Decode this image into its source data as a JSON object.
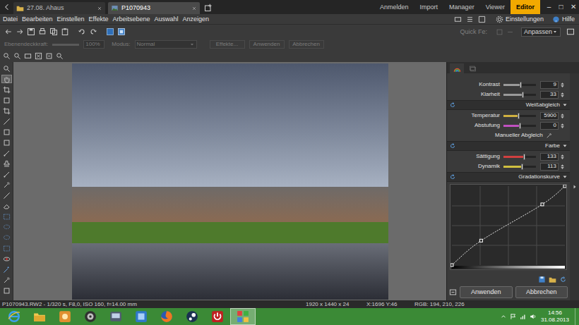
{
  "title_bar": {
    "tabs": [
      {
        "label": "27.08. Ahaus",
        "selected": false
      },
      {
        "label": "P1070943",
        "selected": true
      }
    ],
    "modes": [
      {
        "label": "Anmelden",
        "selected": false
      },
      {
        "label": "Import",
        "selected": false
      },
      {
        "label": "Manager",
        "selected": false
      },
      {
        "label": "Viewer",
        "selected": false
      },
      {
        "label": "Editor",
        "selected": true
      }
    ],
    "window_controls": [
      "–",
      "□",
      "✕"
    ]
  },
  "menu": {
    "items": [
      "Datei",
      "Bearbeiten",
      "Einstellen",
      "Effekte",
      "Arbeitsebene",
      "Auswahl",
      "Anzeigen"
    ],
    "settings": "Einstellungen",
    "help": "Hilfe"
  },
  "toolbar": {
    "quick_fix": "Quick Fe:",
    "fit": "Anpassen"
  },
  "options_bar": {
    "opacity": {
      "label": "Ebenendeckkraft:",
      "value": "100%",
      "level": 1,
      "disabled": true
    },
    "mode": {
      "label": "Modus:",
      "value": "Normal",
      "disabled": true
    },
    "buttons": [
      {
        "label": "Effekte...",
        "disabled": true
      },
      {
        "label": "Anwenden",
        "disabled": true
      },
      {
        "label": "Abbrechen",
        "disabled": true
      }
    ]
  },
  "tools": [
    {
      "kind": "zoom",
      "selected": false
    },
    {
      "kind": "hand",
      "selected": true
    },
    {
      "kind": "crop",
      "selected": false
    },
    {
      "kind": "square",
      "selected": false
    },
    {
      "kind": "crop",
      "selected": false
    },
    {
      "kind": "line",
      "selected": false
    },
    {
      "kind": "square",
      "selected": false
    },
    {
      "kind": "square",
      "selected": false
    },
    {
      "kind": "brush",
      "selected": false
    },
    {
      "kind": "stamp",
      "selected": false
    },
    {
      "kind": "brush",
      "selected": false
    },
    {
      "kind": "dropper",
      "selected": false
    },
    {
      "kind": "line",
      "selected": false
    },
    {
      "kind": "eraser",
      "selected": false
    },
    {
      "kind": "select",
      "selected": false
    },
    {
      "kind": "lasso",
      "selected": false
    },
    {
      "kind": "lasso",
      "selected": false
    },
    {
      "kind": "select",
      "selected": false
    },
    {
      "kind": "redeye",
      "selected": false
    },
    {
      "kind": "wand",
      "selected": false
    },
    {
      "kind": "dropper",
      "selected": false
    },
    {
      "kind": "square",
      "selected": false
    }
  ],
  "panel": {
    "tabs": [
      {
        "kind": "develop",
        "selected": true
      },
      {
        "kind": "layers",
        "selected": false
      }
    ],
    "rows": [
      {
        "kind": "slider",
        "label": "Kontrast",
        "value": "9",
        "level": 0.52,
        "color": "#9a9a9a"
      },
      {
        "kind": "slider",
        "label": "Klarheit",
        "value": "33",
        "level": 0.58,
        "color": "#9a9a9a"
      },
      {
        "kind": "header",
        "label": "Weißabgleich",
        "expanded": true
      },
      {
        "kind": "slider",
        "label": "Temperatur",
        "value": "5900",
        "level": 0.45,
        "color": "#d0b040"
      },
      {
        "kind": "slider",
        "label": "Abstufung",
        "value": "0",
        "level": 0.5,
        "color": "#c050c0"
      },
      {
        "kind": "button",
        "label": "Manueller Abgleich"
      },
      {
        "kind": "header",
        "label": "Farbe",
        "expanded": true
      },
      {
        "kind": "slider",
        "label": "Sättigung",
        "value": "133",
        "level": 0.62,
        "color": "#d04040"
      },
      {
        "kind": "slider",
        "label": "Dynamik",
        "value": "113",
        "level": 0.57,
        "color": "#d0c040"
      },
      {
        "kind": "header",
        "label": "Gradationskurve",
        "expanded": true
      }
    ],
    "curve": {
      "points": [
        [
          0,
          0
        ],
        [
          66,
          79
        ],
        [
          204,
          196
        ],
        [
          255,
          255
        ]
      ]
    },
    "buttons": [
      "Anwenden",
      "Abbrechen"
    ]
  },
  "status_bar": {
    "file_info": "P1070943.RW2 - 1/320 s, F8,0, ISO 160, f=14.00 mm",
    "dimensions": "1920 x 1440 x 24",
    "cursor": "X:1696 Y:46",
    "rgb": "RGB: 194, 210, 226"
  },
  "taskbar": {
    "apps": [
      {
        "kind": "ie",
        "selected": false
      },
      {
        "kind": "explorer",
        "selected": false
      },
      {
        "kind": "tool",
        "selected": false
      },
      {
        "kind": "disc",
        "selected": false
      },
      {
        "kind": "game",
        "selected": false
      },
      {
        "kind": "control",
        "selected": false
      },
      {
        "kind": "firefox",
        "selected": false
      },
      {
        "kind": "steam",
        "selected": false
      },
      {
        "kind": "power",
        "selected": false
      },
      {
        "kind": "zoner",
        "selected": true
      }
    ],
    "time": "14:56",
    "date": "31.08.2013"
  }
}
